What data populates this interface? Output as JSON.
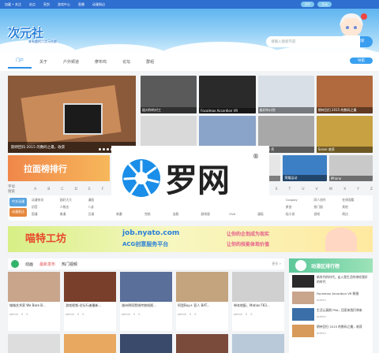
{
  "topbar": {
    "links": [
      "加載 • 关注",
      "站点",
      "亮剑",
      "游戏中心",
      "直播",
      "动漫周边"
    ],
    "right": [
      "DIY",
      "活动"
    ]
  },
  "logo": {
    "name": "次元社",
    "tagline": "来有趣的二次元社群"
  },
  "search": {
    "placeholder": "请输入搜索内容",
    "button": "搜索"
  },
  "nav": {
    "items": [
      "门户",
      "关于",
      "户外频道",
      "摩布鸡",
      "论坛",
      "群组"
    ],
    "right_tag": "导航"
  },
  "hero": {
    "caption": "期待回归 2015 的数码之最，收获"
  },
  "thumbs": [
    {
      "cap": "极对你的对工"
    },
    {
      "cap": "Focalmax Accordion VR"
    },
    {
      "cap": "极好的计划"
    },
    {
      "cap": "期待回归 2015 的数码之最"
    },
    {
      "cap": "Pinp 点点品"
    },
    {
      "cap": "生活认真"
    },
    {
      "cap": "iPhone 壳"
    },
    {
      "cap": "Saisei 收获"
    }
  ],
  "rank": {
    "label": "拉面榜排行"
  },
  "rank_thumbs": [
    {
      "cap": "Matias TK..."
    },
    {
      "cap": "荣耀运动"
    },
    {
      "cap": "IPhone"
    }
  ],
  "alpha": {
    "label": "字母搜索",
    "letters": [
      "A",
      "B",
      "C",
      "D",
      "E",
      "F",
      "G",
      "H",
      "I",
      "J",
      "K",
      "L",
      "M",
      "N",
      "O",
      "P",
      "Q",
      "R",
      "S",
      "T",
      "U",
      "V",
      "W",
      "X",
      "Y",
      "Z"
    ]
  },
  "cats": {
    "badges": [
      "中文动漫",
      "动漫直达"
    ],
    "items": [
      "动漫快讯",
      "画好大大",
      "漫画",
      "冷门资讯",
      "游戏天国",
      "书画",
      "新闻",
      "动漫资讯",
      "小说",
      "Cosplay",
      "同人创作",
      "在线观看",
      "初音",
      "人物志",
      "八卦",
      "模型",
      "壁纸",
      "动漫小说",
      "特攝",
      "音乐",
      "学习",
      "原创",
      "热门剧",
      "其他",
      "国漫",
      "美漫",
      "日漫",
      "新番",
      "完结",
      "连载",
      "剧场版",
      "OVA",
      "漫画",
      "轻小说",
      "游戏",
      "周边"
    ]
  },
  "bigbanner": {
    "left": "喵特工坊",
    "url": "job.nyato.com",
    "sub": "ACG创意服务平台",
    "r1": "让你的企划成为现实",
    "r2": "让你的技能体现价值"
  },
  "section": {
    "title": "动画",
    "tabs": [
      "最新发布",
      "热门视频"
    ],
    "more": "更多 »"
  },
  "cards": [
    {
      "title": "城城艺术家 We Bare B...",
      "user": "admin",
      "views": "0",
      "likes": "0"
    },
    {
      "title": "游戏视频-近衍行者最新...",
      "user": "admin",
      "views": "0",
      "likes": "0"
    },
    {
      "title": "湖州明同黑线传统线视...",
      "user": "admin",
      "views": "0",
      "likes": "0"
    },
    {
      "title": "阿里Buy+ 宣人 BAT...",
      "user": "admin",
      "views": "0",
      "likes": "0"
    },
    {
      "title": "带本地配，Matias FK3...",
      "user": "admin",
      "views": "0",
      "likes": "0"
    }
  ],
  "side": {
    "title": "动漫区排行榜",
    "rows": [
      {
        "t": "新时代的时代，走入我生活的带给我好的时代",
        "u": "admin"
      },
      {
        "t": "Focalmax Accordion VR 眼镜",
        "u": "admin"
      },
      {
        "t": "生活认真期 Pfid，回家来我们带来",
        "u": "admin"
      },
      {
        "t": "期待回归 2015 的数码之最，收获",
        "u": "admin"
      }
    ]
  },
  "watermark": {
    "text": "罗网",
    "reg": "®"
  }
}
